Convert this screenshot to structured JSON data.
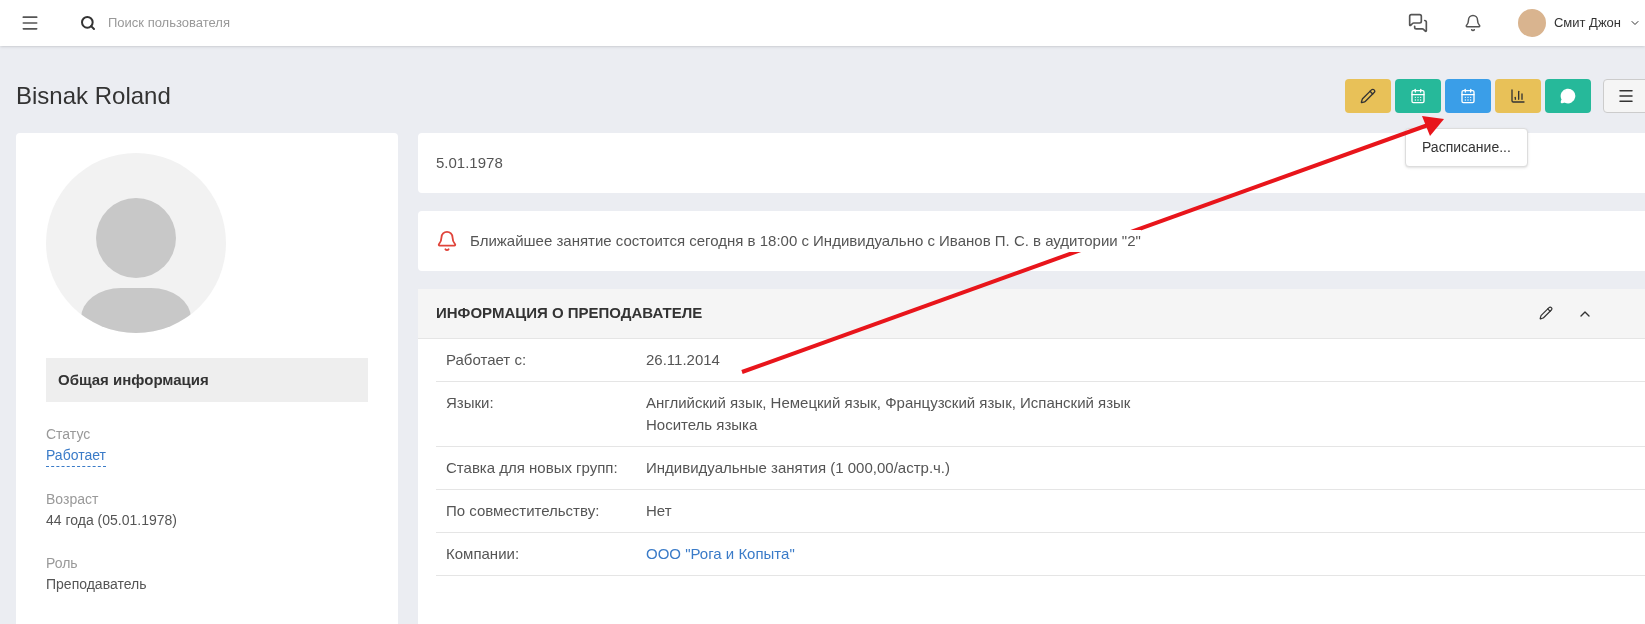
{
  "topbar": {
    "search": {
      "placeholder": "Поиск пользователя"
    },
    "user": {
      "name": "Смит Джон"
    }
  },
  "page": {
    "title": "Bisnak Roland"
  },
  "toolbar": {
    "buttons": [
      {
        "kind": "edit",
        "color": "#e8c158"
      },
      {
        "kind": "calendar",
        "color": "#26b99a"
      },
      {
        "kind": "calendar",
        "color": "#3a9ee8",
        "tooltip": "Расписание..."
      },
      {
        "kind": "chart",
        "color": "#e8c158"
      },
      {
        "kind": "chat",
        "color": "#26b99a"
      },
      {
        "kind": "menu",
        "color": "#f5f5f5"
      }
    ]
  },
  "profile": {
    "section": "Общая информация",
    "fields": [
      {
        "label": "Статус",
        "value": "Работает",
        "kind": "link"
      },
      {
        "label": "Возраст",
        "value": "44 года (05.01.1978)",
        "kind": "text"
      },
      {
        "label": "Роль",
        "value": "Преподаватель",
        "kind": "text"
      }
    ]
  },
  "birthdate": "5.01.1978",
  "notice": "Ближайшее занятие состоится сегодня в 18:00 с Индивидуально с Иванов П. С. в аудитории \"2\"",
  "info": {
    "title": "ИНФОРМАЦИЯ О ПРЕПОДАВАТЕЛЕ",
    "expanded": true,
    "rows": [
      {
        "label": "Работает с:",
        "lines": [
          "26.11.2014"
        ],
        "kind": "text"
      },
      {
        "label": "Языки:",
        "lines": [
          "Английский язык, Немецкий язык, Французский язык, Испанский язык",
          "Носитель языка"
        ],
        "kind": "text"
      },
      {
        "label": "Ставка для новых групп:",
        "lines": [
          "Индивидуальные занятия (1 000,00/астр.ч.)"
        ],
        "kind": "text"
      },
      {
        "label": "По совместительству:",
        "lines": [
          "Нет"
        ],
        "kind": "text"
      },
      {
        "label": "Компании:",
        "lines": [
          "ООО \"Рога и Копыта\""
        ],
        "kind": "link"
      }
    ]
  }
}
